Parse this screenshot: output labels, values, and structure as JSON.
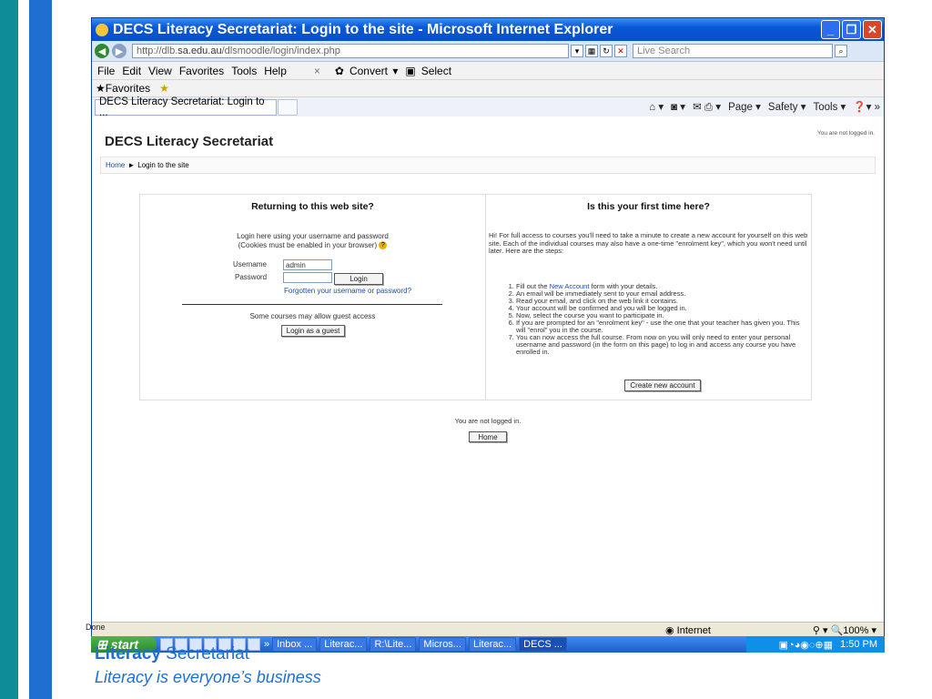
{
  "slide": {
    "footer_line1_bold": "Literacy",
    "footer_line1_rest": " Secretariat",
    "footer_line2": "Literacy is everyone’s business"
  },
  "window": {
    "title": "DECS Literacy Secretariat: Login to the site - Microsoft Internet Explorer",
    "minimize_icon": "minimize-icon",
    "maximize_icon": "restore-icon",
    "close_icon": "close-icon"
  },
  "address_bar": {
    "url_prefix": "http://dlb.",
    "url_domain": "sa.edu.au",
    "url_path": "/dlsmoodle/login/index.php",
    "search_placeholder": "Live Search"
  },
  "menu": {
    "items": [
      "File",
      "Edit",
      "View",
      "Favorites",
      "Tools",
      "Help"
    ],
    "convert": "Convert",
    "select": "Select"
  },
  "favorites": {
    "label": "Favorites"
  },
  "tabs": {
    "active": "DECS Literacy Secretariat: Login to ...",
    "cmd_page": "Page",
    "cmd_safety": "Safety",
    "cmd_tools": "Tools"
  },
  "page": {
    "site_name": "DECS Literacy Secretariat",
    "not_logged_top": "You are not logged in.",
    "breadcrumb_home": "Home",
    "breadcrumb_sep": "►",
    "breadcrumb_current": "Login to the site",
    "left": {
      "heading": "Returning to this web site?",
      "intro1": "Login here using your username and password",
      "intro2": "(Cookies must be enabled in your browser)",
      "username_label": "Username",
      "username_value": "admin",
      "password_label": "Password",
      "login_button": "Login",
      "forgot_link": "Forgotten your username or password?",
      "guest_text": "Some courses may allow guest access",
      "guest_button": "Login as a guest"
    },
    "right": {
      "heading": "Is this your first time here?",
      "intro": "Hi! For full access to courses you'll need to take a minute to create a new account for yourself on this web site. Each of the individual courses may also have a one-time \"enrolment key\", which you won't need until later. Here are the steps:",
      "step1_pre": "Fill out the ",
      "step1_link": "New Account",
      "step1_post": " form with your details.",
      "steps": [
        "An email will be immediately sent to your email address.",
        "Read your email, and click on the web link it contains.",
        "Your account will be confirmed and you will be logged in.",
        "Now, select the course you want to participate in.",
        "If you are prompted for an \"enrolment key\" - use the one that your teacher has given you. This will \"enrol\" you in the course.",
        "You can now access the full course. From now on you will only need to enter your personal username and password (in the form on this page) to log in and access any course you have enrolled in."
      ],
      "create_button": "Create new account"
    },
    "bottom_not_logged": "You are not logged in.",
    "bottom_home_button": "Home"
  },
  "status": {
    "done": "Done",
    "zone": "Internet",
    "zoom": "100%"
  },
  "taskbar": {
    "start": "start",
    "items": [
      "Inbox ...",
      "Literac...",
      "R:\\Lite...",
      "Micros...",
      "Literac...",
      "DECS ..."
    ],
    "clock": "1:50 PM"
  }
}
